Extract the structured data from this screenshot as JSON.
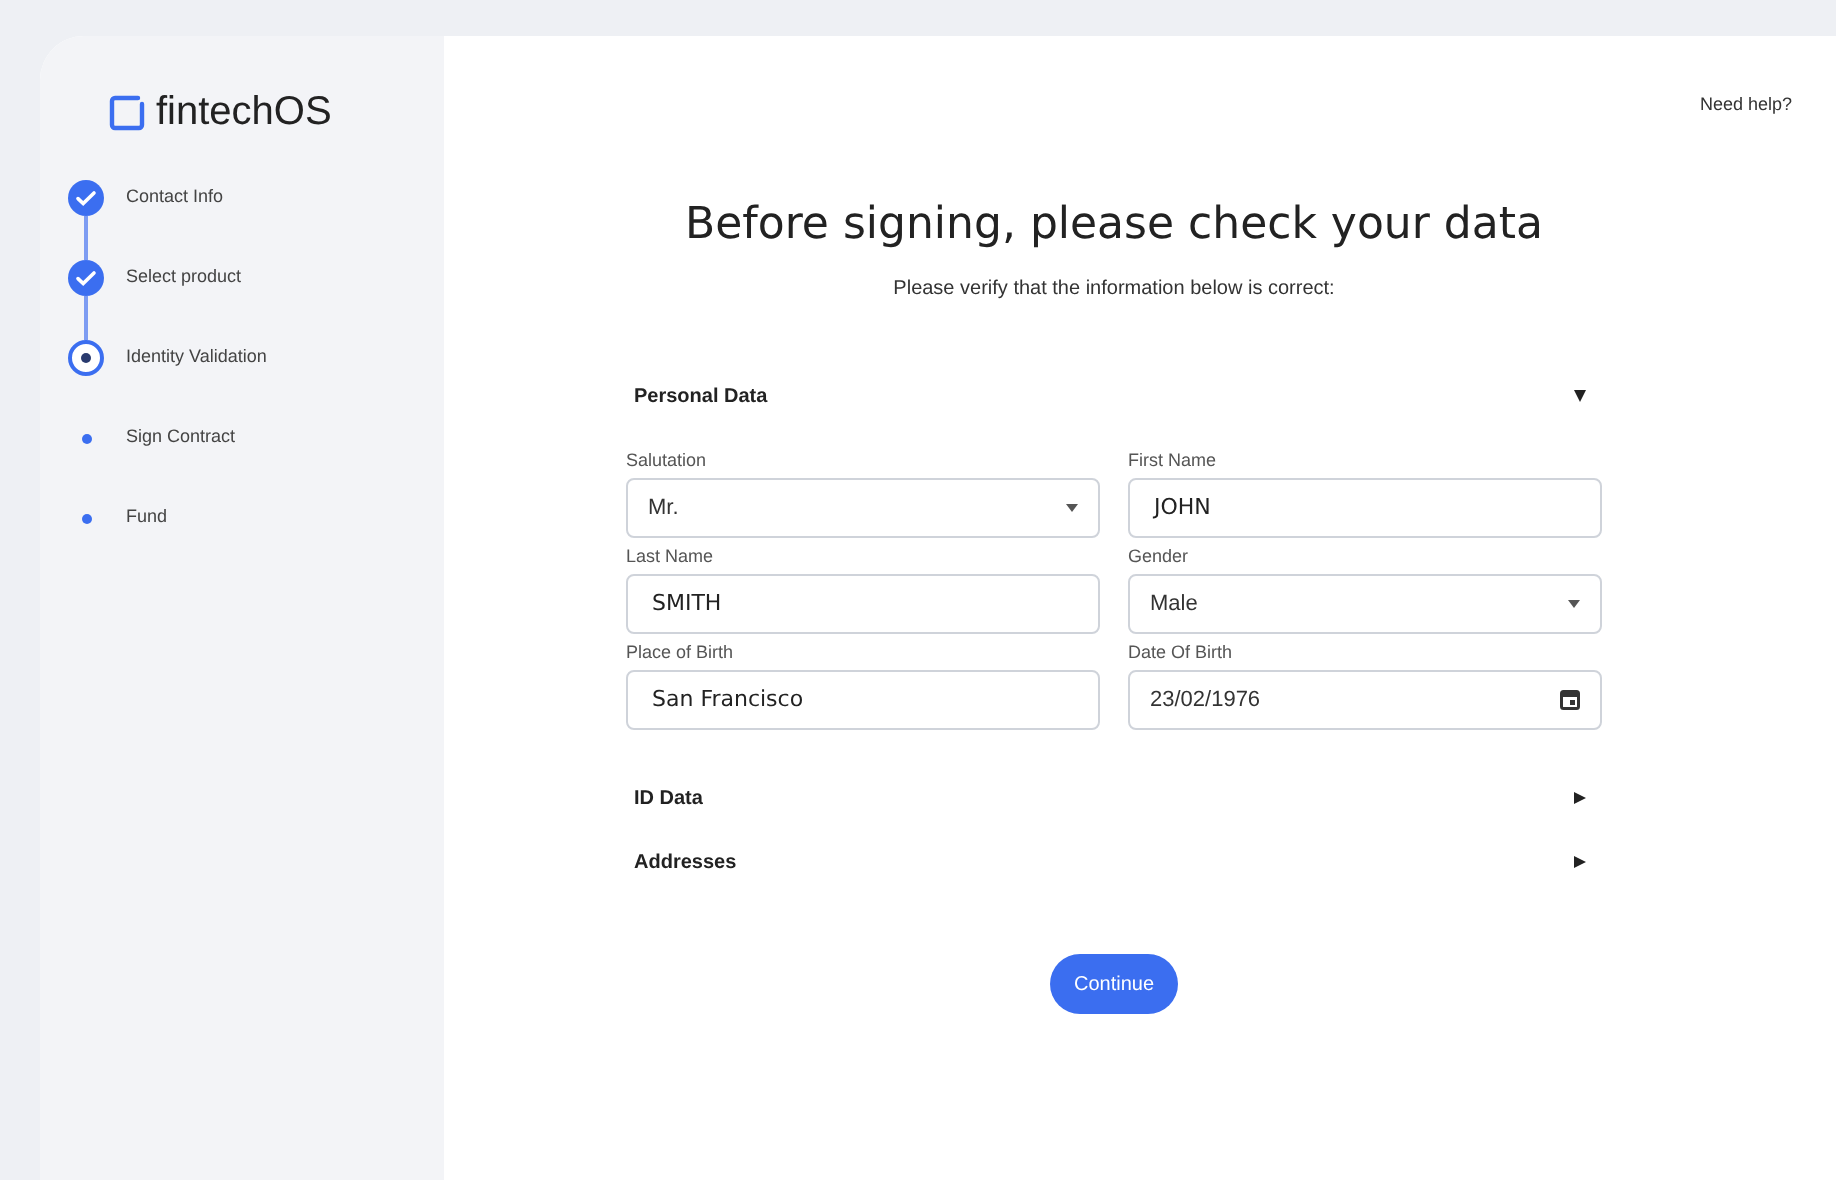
{
  "logo": {
    "text": "fintechOS"
  },
  "steps": [
    {
      "label": "Contact Info",
      "completed": true,
      "selected": false
    },
    {
      "label": "Select product",
      "completed": true,
      "selected": false
    },
    {
      "label": "Identity Validation",
      "completed": false,
      "selected": true
    },
    {
      "label": "Sign Contract",
      "completed": false,
      "selected": false
    },
    {
      "label": "Fund",
      "completed": false,
      "selected": false
    }
  ],
  "help_link": "Need help?",
  "title": "Before signing, please check your data",
  "subtitle": "Please verify that the information below is correct:",
  "sections": [
    {
      "title": "Personal Data",
      "expanded": true,
      "fields": [
        {
          "label": "Salutation",
          "kind": "select",
          "value": "Mr."
        },
        {
          "label": "First Name",
          "kind": "text",
          "value": "JOHN"
        },
        {
          "label": "Last Name",
          "kind": "text",
          "value": "SMITH"
        },
        {
          "label": "Gender",
          "kind": "select",
          "value": "Male"
        },
        {
          "label": "Place of Birth",
          "kind": "text",
          "value": "San Francisco"
        },
        {
          "label": "Date Of Birth",
          "kind": "date",
          "value": "23/02/1976"
        }
      ]
    },
    {
      "title": "ID Data",
      "expanded": false
    },
    {
      "title": "Addresses",
      "expanded": false
    }
  ],
  "continue_button": "Continue"
}
